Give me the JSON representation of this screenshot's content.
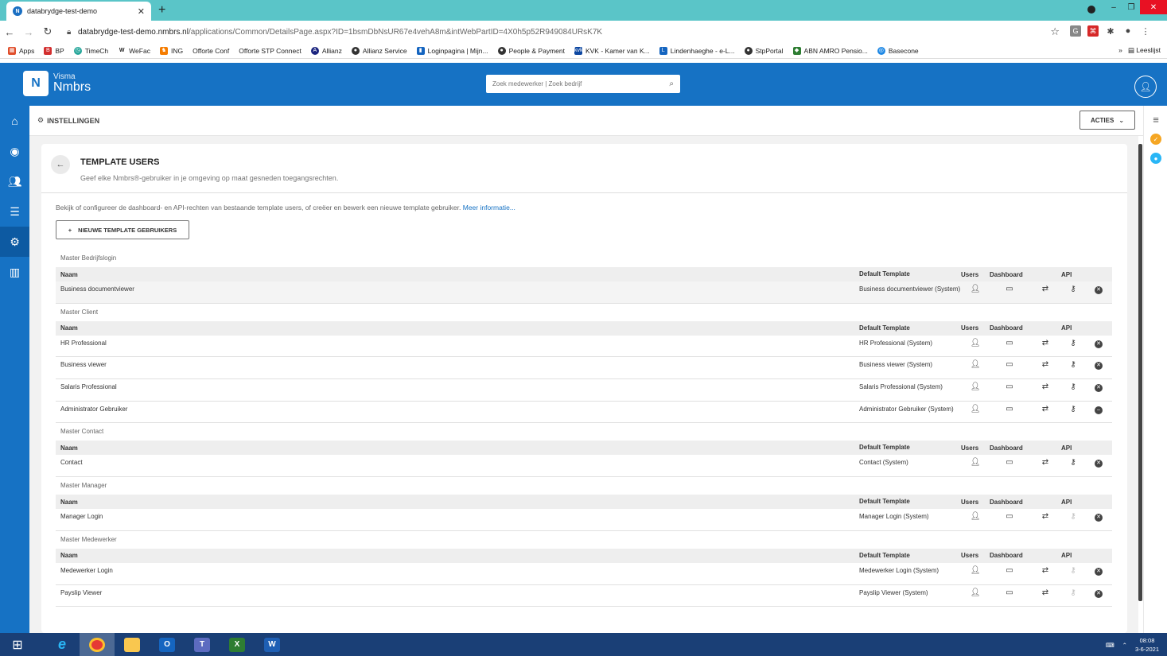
{
  "browser": {
    "tab_title": "databrydge-test-demo",
    "url_host": "databrydge-test-demo.nmbrs.nl",
    "url_path": "/applications/Common/DetailsPage.aspx?ID=1bsmDbNsUR67e4vehA8m&intWebPartID=4X0h5p52R949084URsK7K",
    "bookmarks": [
      "Apps",
      "BP",
      "TimeCh",
      "WeFac",
      "ING",
      "Offorte Conf",
      "Offorte STP Connect",
      "Allianz",
      "Allianz Service",
      "Loginpagina | Mijn...",
      "People & Payment",
      "KVK - Kamer van K...",
      "Lindenhaeghe - e-L...",
      "StpPortal",
      "ABN AMRO Pensio...",
      "Basecone"
    ],
    "more_bookmarks": "»",
    "reading_list": "Leeslijst"
  },
  "header": {
    "logo_top": "Visma",
    "logo_bottom": "Nmbrs",
    "logo_mark": "N",
    "search_placeholder": "Zoek medewerker | Zoek bedrijf"
  },
  "subheader": {
    "title": "INSTELLINGEN",
    "actions_label": "ACTIES"
  },
  "page": {
    "title": "TEMPLATE USERS",
    "subtitle": "Geef elke Nmbrs®-gebruiker in je omgeving op maat gesneden toegangsrechten.",
    "intro": "Bekijk of configureer de dashboard- en API-rechten van bestaande template users, of creëer en bewerk een nieuwe template gebruiker.",
    "intro_link": "Meer informatie...",
    "new_button": "NIEUWE TEMPLATE GEBRUIKERS",
    "columns": {
      "name": "Naam",
      "default_template": "Default Template",
      "users": "Users",
      "dashboard": "Dashboard",
      "api": "API"
    },
    "groups": [
      {
        "title": "Master Bedrijfslogin",
        "rows": [
          {
            "name": "Business documentviewer",
            "default": "Business documentviewer (System)",
            "api_active": true,
            "delete_type": "x",
            "highlight": true
          }
        ]
      },
      {
        "title": "Master Client",
        "rows": [
          {
            "name": "HR Professional",
            "default": "HR Professional (System)",
            "api_active": true,
            "delete_type": "x"
          },
          {
            "name": "Business viewer",
            "default": "Business viewer (System)",
            "api_active": true,
            "delete_type": "x"
          },
          {
            "name": "Salaris Professional",
            "default": "Salaris Professional (System)",
            "api_active": true,
            "delete_type": "x"
          },
          {
            "name": "Administrator Gebruiker",
            "default": "Administrator Gebruiker (System)",
            "api_active": true,
            "delete_type": "minus"
          }
        ]
      },
      {
        "title": "Master Contact",
        "rows": [
          {
            "name": "Contact",
            "default": "Contact (System)",
            "api_active": true,
            "delete_type": "x"
          }
        ]
      },
      {
        "title": "Master Manager",
        "rows": [
          {
            "name": "Manager Login",
            "default": "Manager Login (System)",
            "api_active": false,
            "delete_type": "x"
          }
        ]
      },
      {
        "title": "Master Medewerker",
        "rows": [
          {
            "name": "Medewerker Login",
            "default": "Medewerker Login (System)",
            "api_active": false,
            "delete_type": "x"
          },
          {
            "name": "Payslip Viewer",
            "default": "Payslip Viewer (System)",
            "api_active": false,
            "delete_type": "x"
          }
        ]
      }
    ]
  },
  "taskbar": {
    "time": "08:08",
    "date": "3-6-2021"
  },
  "colors": {
    "brand_blue": "#1672c4",
    "tab_strip": "#5ac5c8",
    "taskbar": "#1a3f76"
  }
}
